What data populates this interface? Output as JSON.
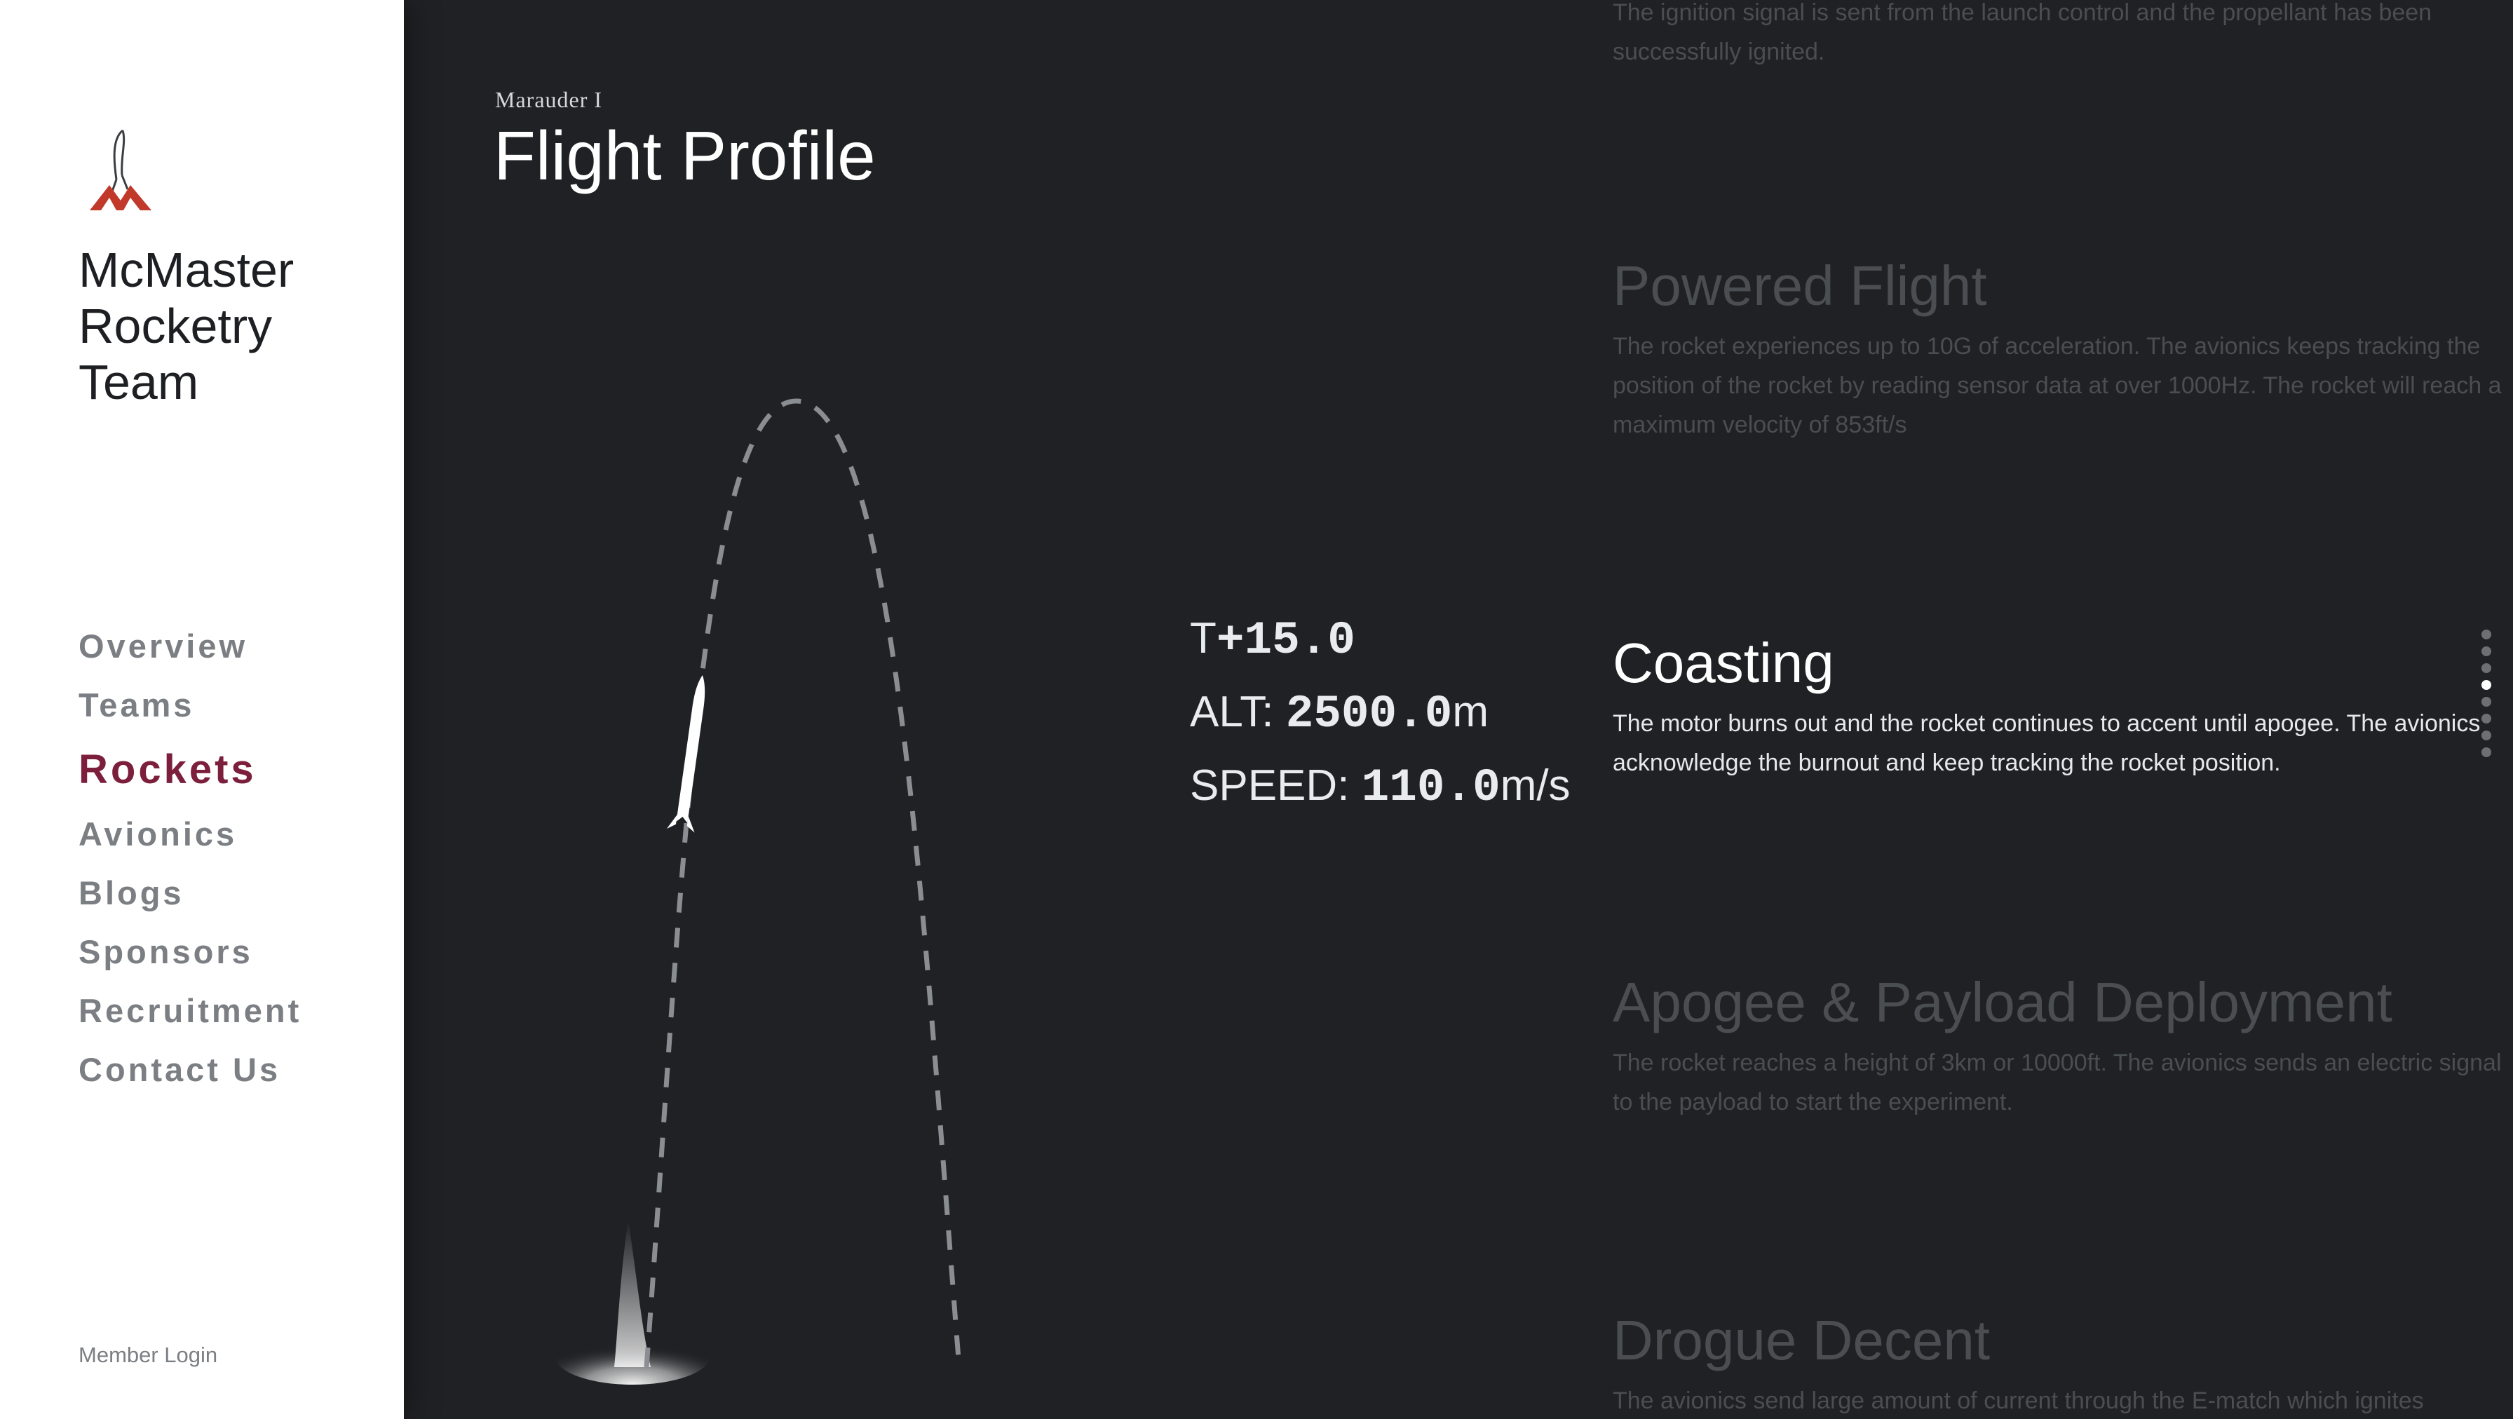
{
  "sidebar": {
    "team_name": "McMaster\nRocketry\nTeam",
    "nav": [
      {
        "label": "Overview",
        "active": false
      },
      {
        "label": "Teams",
        "active": false
      },
      {
        "label": "Rockets",
        "active": true
      },
      {
        "label": "Avionics",
        "active": false
      },
      {
        "label": "Blogs",
        "active": false
      },
      {
        "label": "Sponsors",
        "active": false
      },
      {
        "label": "Recruitment",
        "active": false
      },
      {
        "label": "Contact Us",
        "active": false
      }
    ],
    "member_login": "Member Login"
  },
  "header": {
    "rocket_name": "Marauder I",
    "title": "Flight Profile"
  },
  "telemetry": {
    "time_prefix": "T",
    "time_value": "+15.0",
    "alt_label": "ALT: ",
    "alt_value": "2500.0",
    "alt_unit": "m",
    "speed_label": "SPEED: ",
    "speed_value": "110.0",
    "speed_unit": "m/s"
  },
  "phases": [
    {
      "title": "",
      "text": "The ignition signal is sent from the launch control and the propellant has been successfully ignited.",
      "active": false
    },
    {
      "title": "Powered Flight",
      "text": "The rocket experiences up to 10G of acceleration. The avionics keeps tracking the position of the rocket by reading sensor data at over 1000Hz. The rocket will reach a maximum velocity of 853ft/s",
      "active": false
    },
    {
      "title": "Coasting",
      "text": "The motor burns out and the rocket continues to accent until apogee. The avionics acknowledge the burnout and keep tracking the rocket position.",
      "active": true
    },
    {
      "title": "Apogee & Payload Deployment",
      "text": "The rocket reaches a height of 3km or 10000ft. The avionics sends an electric signal to the payload to start the experiment.",
      "active": false
    },
    {
      "title": "Drogue Decent",
      "text": "The avionics send large amount of current through the E-match which ignites",
      "active": false
    }
  ],
  "page_dots": {
    "count": 8,
    "active_index": 3
  },
  "colors": {
    "sidebar_bg": "#ffffff",
    "main_bg": "#1f2124",
    "accent": "#7b1f3c",
    "logo_red": "#c0392b",
    "nav_text": "#7b7e82",
    "inactive_phase_text": "#4a4d51",
    "active_phase_text": "#ffffff"
  },
  "icons": {
    "logo": "rocket-mountains-logo",
    "rocket": "rocket-icon",
    "exhaust": "exhaust-plume"
  }
}
